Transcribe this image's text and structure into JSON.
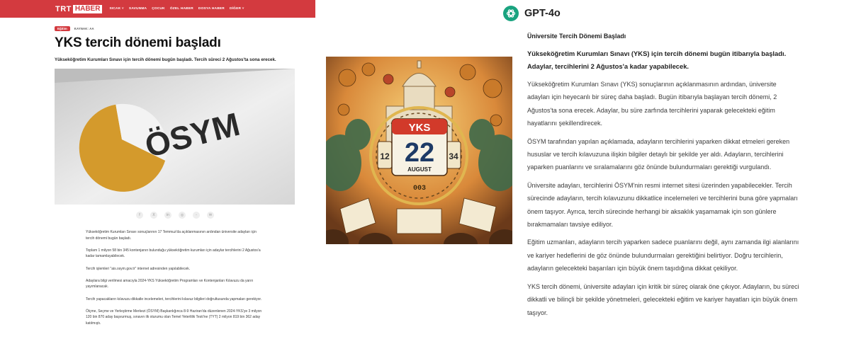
{
  "trt": {
    "logo_trt": "TRT",
    "logo_haber": "HABER",
    "nav": [
      "SICAK ˅",
      "SAVUNMA",
      "ÇOCUK",
      "ÖZEL HABER",
      "DOSYA HABER",
      "DİĞER ˅"
    ],
    "category": "Eğitim",
    "source": "KAYNAK: AA",
    "title": "YKS tercih dönemi başladı",
    "spot": "Yükseköğretim Kurumları Sınavı için tercih dönemi bugün başladı. Tercih süreci 2 Ağustos'ta sona erecek.",
    "photo_text": "ÖSYM",
    "share_icons": [
      "facebook-icon",
      "x-icon",
      "linkedin-icon",
      "whatsapp-icon",
      "telegram-icon",
      "email-icon"
    ],
    "share_glyphs": [
      "f",
      "X",
      "in",
      "◎",
      "◦",
      "✉"
    ],
    "body": [
      "Yükseköğretim Kurumları Sınavı sonuçlarının 17 Temmuz'da açıklanmasının ardından üniversite adayları için tercih dönemi bugün başladı.",
      "Toplam 1 milyon 58 bin 345 kontenjanın bulunduğu yükseköğretim kurumları için adaylar tercihlerini 2 Ağustos'a kadar tamamlayabilecek.",
      "Tercih işlemleri \"ais.osym.gov.tr\" internet adresinden yapılabilecek.",
      "Adaylara bilgi verilmesi amacıyla 2024-YKS Yükseköğretim Programları ve Kontenjanları Kılavuzu da yarın yayımlanacak.",
      "Tercih yapacakların kılavuzu dikkatle incelemeleri, tercihlerini kılavuz bilgileri doğrultusunda yapmaları gerekiyor.",
      "Ölçme, Seçme ve Yerleştirme Merkezi (ÖSYM) Başkanlığınca 8-9 Haziran'da düzenlenen 2024-YKS'ye 3 milyon 120 bin 870 aday başvurmuş, sınavın ilk oturumu olan Temel Yeterlilik Testi'ne (TYT) 2 milyon 819 bin 362 aday katılmıştı."
    ]
  },
  "generated_image": {
    "calendar_top": "YKS",
    "calendar_day": "22",
    "calendar_month": "AUGUST",
    "left_dial": "12",
    "right_dial": "34",
    "bottom_digits": "003"
  },
  "gpt": {
    "model_name": "GPT-4o",
    "heading": "Üniversite Tercih Dönemi Başladı",
    "lead": "Yükseköğretim Kurumları Sınavı (YKS) için tercih dönemi bugün itibarıyla başladı. Adaylar, tercihlerini 2 Ağustos'a kadar yapabilecek.",
    "paragraphs": [
      "Yükseköğretim Kurumları Sınavı (YKS) sonuçlarının açıklanmasının ardından, üniversite adayları için heyecanlı bir süreç daha başladı. Bugün itibarıyla başlayan tercih dönemi, 2 Ağustos'ta sona erecek. Adaylar, bu süre zarfında tercihlerini yaparak gelecekteki eğitim hayatlarını şekillendirecek.",
      "ÖSYM tarafından yapılan açıklamada, adayların tercihlerini yaparken dikkat etmeleri gereken hususlar ve tercih kılavuzuna ilişkin bilgiler detaylı bir şekilde yer aldı. Adayların, tercihlerini yaparken puanlarını ve sıralamalarını göz önünde bulundurmaları gerektiği vurgulandı.",
      "Üniversite adayları, tercihlerini ÖSYM'nin resmi internet sitesi üzerinden yapabilecekler. Tercih sürecinde adayların, tercih kılavuzunu dikkatlice incelemeleri ve tercihlerini buna göre yapmaları önem taşıyor. Ayrıca, tercih sürecinde herhangi bir aksaklık yaşamamak için son günlere bırakmamaları tavsiye ediliyor.",
      "Eğitim uzmanları, adayların tercih yaparken sadece puanlarını değil, aynı zamanda ilgi alanlarını ve kariyer hedeflerini de göz önünde bulundurmaları gerektiğini belirtiyor. Doğru tercihlerin, adayların gelecekteki başarıları için büyük önem taşıdığına dikkat çekiliyor.",
      "YKS tercih dönemi, üniversite adayları için kritik bir süreç olarak öne çıkıyor. Adayların, bu süreci dikkatli ve bilinçli bir şekilde yönetmeleri, gelecekteki eğitim ve kariyer hayatları için büyük önem taşıyor."
    ]
  },
  "colors": {
    "trt_red": "#d33a3f",
    "gpt_green": "#19a37f",
    "panel_bg": "#f4f4f5"
  }
}
